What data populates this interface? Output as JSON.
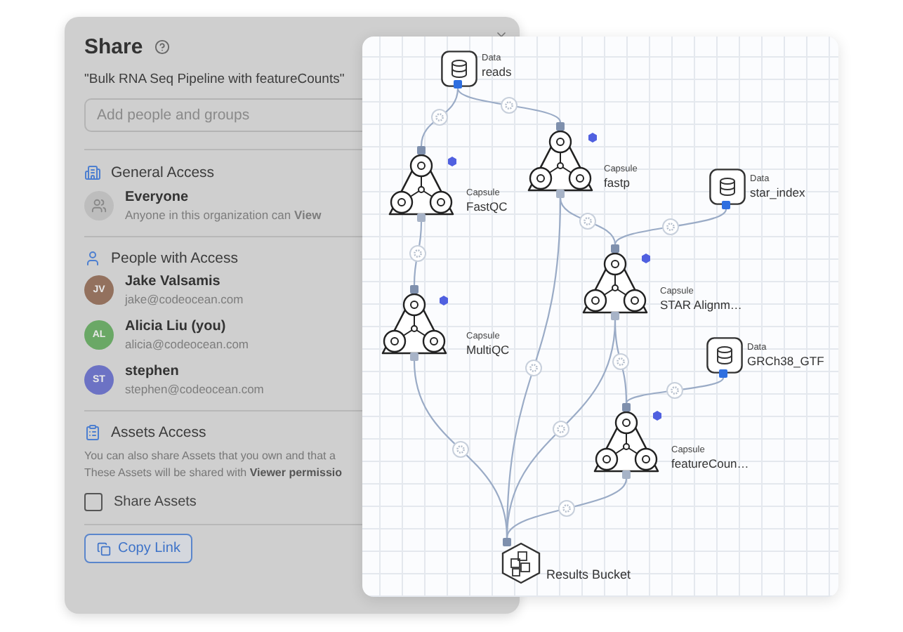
{
  "share_panel": {
    "title": "Share",
    "subtitle": "\"Bulk RNA Seq Pipeline with featureCounts\"",
    "search": {
      "placeholder": "Add people and groups"
    },
    "general_access": {
      "heading": "General Access",
      "name": "Everyone",
      "description": "Anyone in this organization can **View**"
    },
    "people": {
      "heading": "People with Access",
      "items": [
        {
          "initials": "JV",
          "name": "Jake Valsamis",
          "email": "jake@codeocean.com",
          "color": "#93715e"
        },
        {
          "initials": "AL",
          "name": "Alicia Liu (you)",
          "email": "alicia@codeocean.com",
          "color": "#6aa866"
        },
        {
          "initials": "ST",
          "name": "stephen",
          "email": "stephen@codeocean.com",
          "color": "#6c72c4"
        }
      ]
    },
    "assets": {
      "heading": "Assets Access",
      "lines": [
        "You can also share Assets that you own and that a",
        "These Assets will be shared with **Viewer permissio**"
      ],
      "checkbox": {
        "label": "Share Assets",
        "checked": false
      }
    },
    "copy_link": "Copy Link"
  },
  "pipeline": {
    "nodes": [
      {
        "kind": "data",
        "type_label": "Data",
        "name": "reads"
      },
      {
        "kind": "capsule",
        "type_label": "Capsule",
        "name": "FastQC"
      },
      {
        "kind": "capsule",
        "type_label": "Capsule",
        "name": "fastp"
      },
      {
        "kind": "capsule",
        "type_label": "Capsule",
        "name": "MultiQC"
      },
      {
        "kind": "data",
        "type_label": "Data",
        "name": "star_index"
      },
      {
        "kind": "capsule",
        "type_label": "Capsule",
        "name": "STAR Alignm…"
      },
      {
        "kind": "data",
        "type_label": "Data",
        "name": "GRCh38_GTF"
      },
      {
        "kind": "capsule",
        "type_label": "Capsule",
        "name": "featureCoun…"
      },
      {
        "kind": "bucket",
        "name": "Results Bucket"
      }
    ]
  }
}
